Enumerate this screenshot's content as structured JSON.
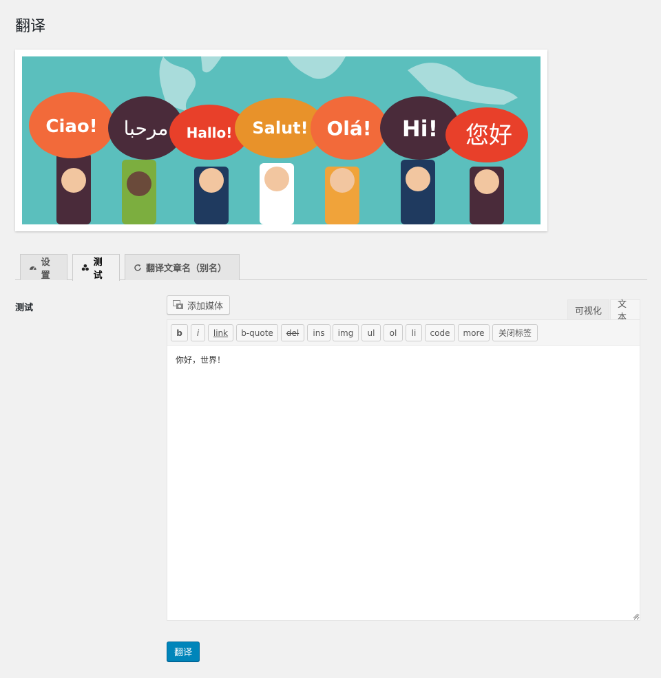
{
  "page": {
    "title": "翻译"
  },
  "banner": {
    "bubbles": [
      "Ciao!",
      "مرحبا",
      "Hallo!",
      "Salut!",
      "Olá!",
      "Hi!",
      "您好"
    ]
  },
  "tabs": [
    {
      "label": "设置",
      "icon": "dashboard-icon"
    },
    {
      "label": "测试",
      "icon": "palette-icon"
    },
    {
      "label": "翻译文章名（别名）",
      "icon": "refresh-icon"
    }
  ],
  "form": {
    "field_label": "测试",
    "media_button": "添加媒体",
    "mode_visual": "可视化",
    "mode_text": "文本",
    "toolbar": [
      "b",
      "i",
      "link",
      "b-quote",
      "del",
      "ins",
      "img",
      "ul",
      "ol",
      "li",
      "code",
      "more",
      "关闭标签"
    ],
    "content": "你好，世界！",
    "submit": "翻译"
  },
  "colors": {
    "accent": "#0085ba",
    "banner_bg": "#5bbfbd"
  }
}
